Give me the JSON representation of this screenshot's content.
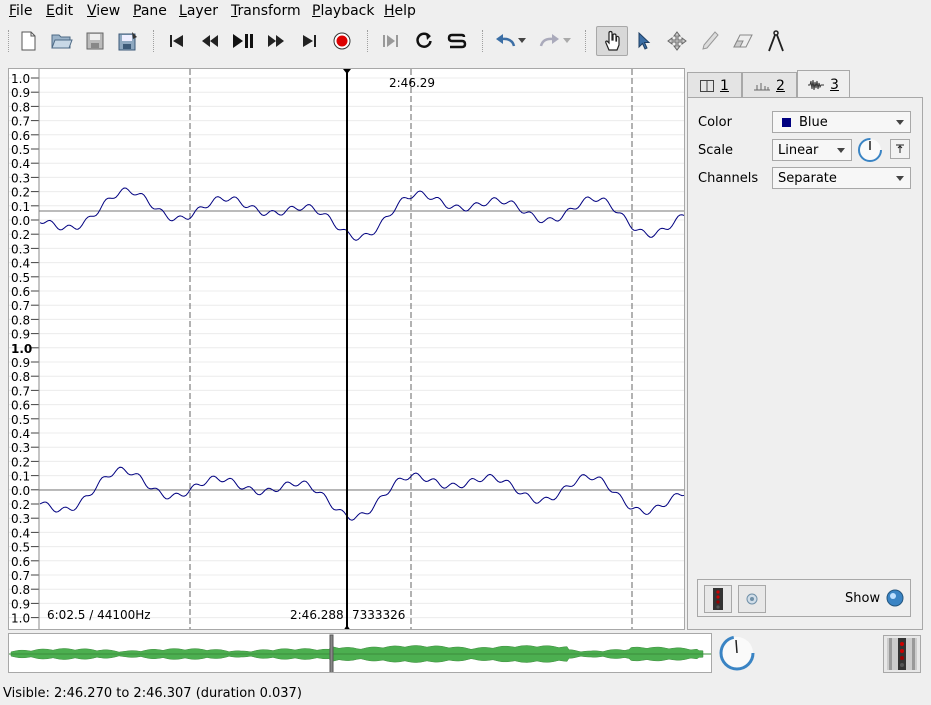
{
  "menu": [
    "File",
    "Edit",
    "View",
    "Pane",
    "Layer",
    "Transform",
    "Playback",
    "Help"
  ],
  "toolbar_icons": [
    "new-file-icon",
    "open-folder-icon",
    "save-icon",
    "save-as-icon",
    "rewind-start-icon",
    "rewind-icon",
    "play-pause-icon",
    "fast-forward-icon",
    "forward-end-icon",
    "record-icon",
    "constrain-playback-icon",
    "loop-icon",
    "solo-icon",
    "undo-icon",
    "redo-icon",
    "navigate-hand-icon",
    "select-arrow-icon",
    "move-icon",
    "draw-pencil-icon",
    "erase-icon",
    "measure-icon"
  ],
  "pane": {
    "cursor_time": "2:46.29",
    "bottom_left": "6:02.5 / 44100Hz",
    "bottom_center": "2:46.288",
    "bottom_frame": "7333326"
  },
  "ruler_labels": [
    "1.0",
    "0.9",
    "0.8",
    "0.7",
    "0.6",
    "0.5",
    "0.4",
    "0.3",
    "0.2",
    "0.1",
    "0.0",
    "0.2",
    "0.3",
    "0.4",
    "0.5",
    "0.6",
    "0.7",
    "0.8",
    "0.9",
    "1.0",
    "0.9",
    "0.8",
    "0.7",
    "0.6",
    "0.5",
    "0.4",
    "0.3",
    "0.2",
    "0.1",
    "0.0",
    "0.2",
    "0.3",
    "0.4",
    "0.5",
    "0.6",
    "0.7",
    "0.8",
    "0.9",
    "1.0"
  ],
  "tabs": [
    {
      "icon": "pane-icon",
      "label": "1"
    },
    {
      "icon": "ruler-icon",
      "label": "2"
    },
    {
      "icon": "waveform-icon",
      "label": "3"
    }
  ],
  "properties": {
    "color_label": "Color",
    "color_value": "Blue",
    "color_swatch": "#000080",
    "scale_label": "Scale",
    "scale_value": "Linear",
    "channels_label": "Channels",
    "channels_value": "Separate",
    "show_label": "Show"
  },
  "status": "Visible: 2:46.270 to 2:46.307 (duration 0.037)",
  "colors": {
    "waveform": "#000080",
    "overview_wave": "#4caf50"
  }
}
